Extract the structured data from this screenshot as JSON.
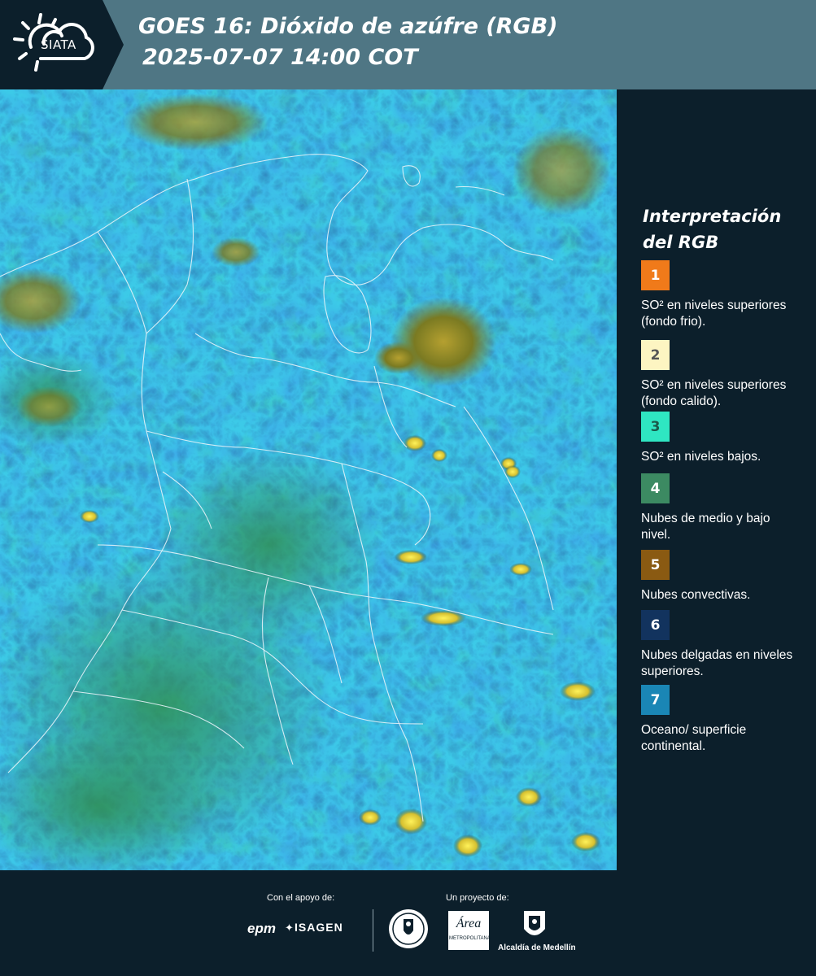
{
  "header": {
    "logo_text": "SIATA",
    "title_line1": "GOES 16: Dióxido de azúfre (RGB)",
    "title_line2": "2025-07-07 14:00 COT"
  },
  "legend": {
    "title": "Interpretación del RGB",
    "items": [
      {
        "number": "1",
        "label": "SO² en niveles superiores (fondo frio).",
        "color": "#f07a1a"
      },
      {
        "number": "2",
        "label": "SO² en niveles superiores (fondo calido).",
        "color": "#fdf5c2"
      },
      {
        "number": "3",
        "label": "SO² en niveles bajos.",
        "color": "#2fe6c2"
      },
      {
        "number": "4",
        "label": "Nubes de medio y bajo nivel.",
        "color": "#3c8a62"
      },
      {
        "number": "5",
        "label": "Nubes convectivas.",
        "color": "#8a5a12"
      },
      {
        "number": "6",
        "label": "Nubes delgadas en niveles superiores.",
        "color": "#12335e"
      },
      {
        "number": "7",
        "label": "Oceano/ superficie continental.",
        "color": "#1a86b5"
      }
    ]
  },
  "footer": {
    "support_caption": "Con el apoyo de:",
    "project_caption": "Un proyecto de:",
    "sponsor1": "epm",
    "sponsor2": "ISAGEN",
    "partner_area_text": "Área",
    "partner_area_sub": "METROPOLITANA",
    "partner_alcaldia": "Alcaldía de Medellín"
  },
  "colors": {
    "background": "#0c1f2b",
    "header_bar": "#4f7684",
    "ocean": "#3aa6d9"
  }
}
